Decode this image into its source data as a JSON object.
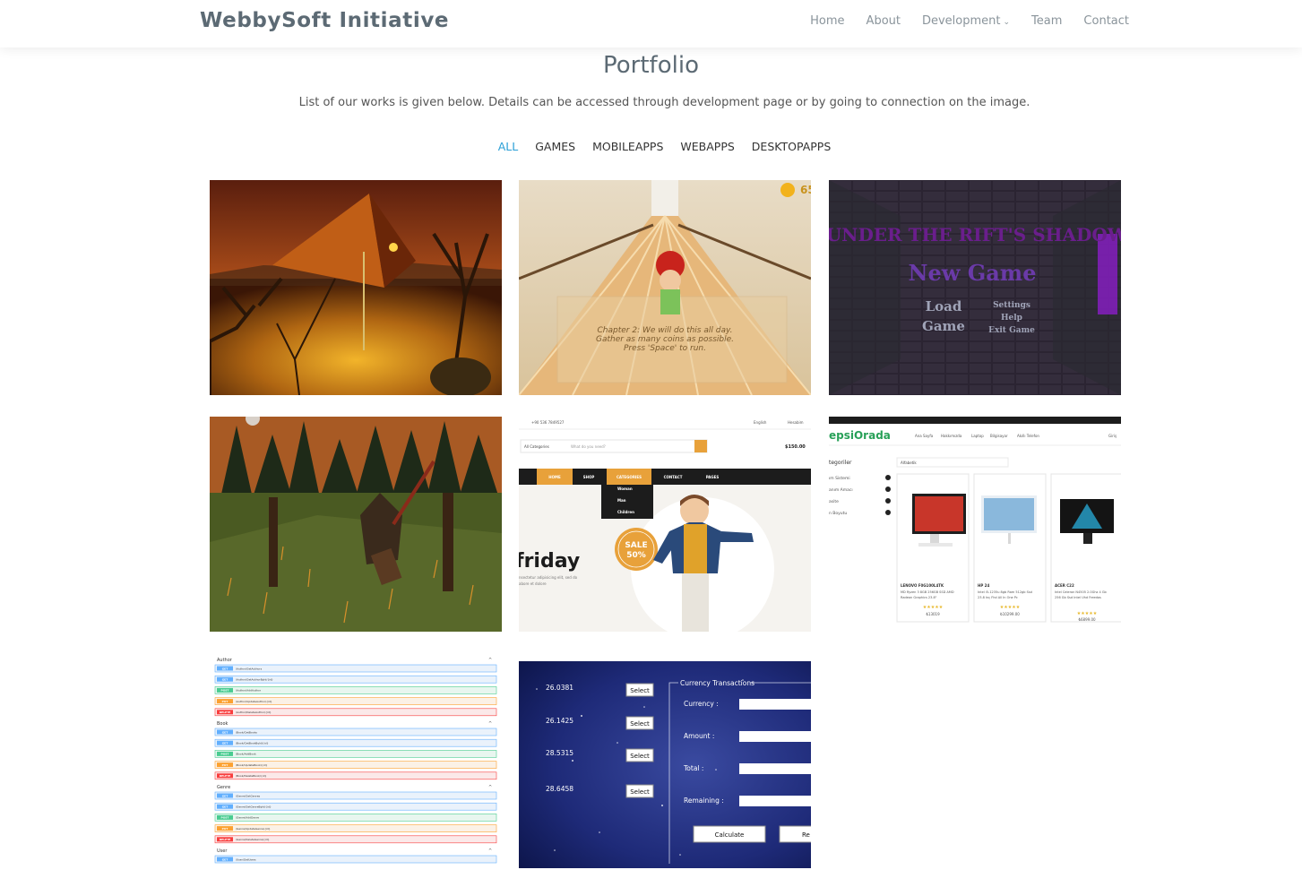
{
  "header": {
    "logo": "WebbySoft Initiative",
    "nav": {
      "home": "Home",
      "about": "About",
      "development": "Development",
      "team": "Team",
      "contact": "Contact"
    }
  },
  "portfolio": {
    "title": "Portfolio",
    "description": "List of our works is given below. Details can be accessed through development page or by going to connection on the image.",
    "filters": [
      "ALL",
      "GAMES",
      "MOBILEAPPS",
      "WEBAPPS",
      "DESKTOPAPPS"
    ],
    "active_filter": "ALL"
  },
  "items": {
    "runner": {
      "coins": "65",
      "chapter": "Chapter 2: We will do this all day.",
      "gather": "Gather as many coins as possible.",
      "press": "Press 'Space' to run."
    },
    "rift": {
      "title": "UNDER THE RIFT'S SHADOW",
      "new_game": "New Game",
      "load": "Load",
      "game": "Game",
      "settings": "Settings",
      "help": "Help",
      "exit": "Exit Game"
    },
    "shop": {
      "phone": "+90 536 7849527",
      "lang": "English",
      "account": "Hesabim",
      "categories": "All Categories",
      "search": "What do you need?",
      "price": "$150.00",
      "menu": [
        "HOME",
        "SHOP",
        "CATEGORIES",
        "CONTACT",
        "PAGES"
      ],
      "dropdown": [
        "Woman",
        "Man",
        "Children"
      ],
      "sale": "SALE",
      "percent": "50%",
      "headline": "friday",
      "sub1": "nsectetur adipisicing elit, sed do",
      "sub2": "abore et dolore"
    },
    "hepsi": {
      "brand": "epsiOrada",
      "nav": [
        "Ana Sayfa",
        "Hakkımızda",
        "Laptop",
        "Bilgisayar",
        "Akıllı Telefon"
      ],
      "login": "Giriş",
      "categories": "tegoriler",
      "search": "Alfabetik",
      "cats": [
        "ım Sistemi",
        "anım Amacı",
        "asite",
        "n Boyutu"
      ],
      "products": [
        {
          "name": "LENOVO F0G100L4TK",
          "desc1": "MD Ryzen 3 8GB 256GB SSD AMD",
          "desc2": "Radeon Graphics 23.8\"",
          "price": "₺13019"
        },
        {
          "name": "HP 24",
          "desc1": "Intel i5-1235u 8gb Ram 512gb Ssd",
          "desc2": "23.8 Inç Fhd All In One Pc",
          "price": "₺10299.00"
        },
        {
          "name": "ACER C22",
          "desc1": "Intel Celeron N4505 2.0Ghz 4 Gb",
          "desc2": "256 Gb Ssd Intel Uhd Freedos",
          "price": "₺6899.00"
        }
      ]
    },
    "api": {
      "groups": [
        {
          "name": "Author",
          "rows": [
            {
              "method": "GET",
              "path": "/Author/GetAuthors"
            },
            {
              "method": "GET",
              "path": "/Author/GetAuthorById/{id}"
            },
            {
              "method": "POST",
              "path": "/Author/AddAuthor"
            },
            {
              "method": "PUT",
              "path": "/Author/UpdateAuthor/{id}"
            },
            {
              "method": "DELETE",
              "path": "/Author/DeleteAuthor/{id}"
            }
          ]
        },
        {
          "name": "Book",
          "rows": [
            {
              "method": "GET",
              "path": "/Book/GetBooks"
            },
            {
              "method": "GET",
              "path": "/Book/GetBookById/{id}"
            },
            {
              "method": "POST",
              "path": "/Book/AddBook"
            },
            {
              "method": "PUT",
              "path": "/Book/UpdateBook/{id}"
            },
            {
              "method": "DELETE",
              "path": "/Book/DeleteBook/{id}"
            }
          ]
        },
        {
          "name": "Genre",
          "rows": [
            {
              "method": "GET",
              "path": "/Genre/GetGenres"
            },
            {
              "method": "GET",
              "path": "/Genre/GetGenreById/{id}"
            },
            {
              "method": "POST",
              "path": "/Genre/AddGenre"
            },
            {
              "method": "PUT",
              "path": "/Genre/UpdateGenre/{id}"
            },
            {
              "method": "DELETE",
              "path": "/Genre/DeleteGenre/{id}"
            }
          ]
        },
        {
          "name": "User",
          "rows": [
            {
              "method": "GET",
              "path": "/User/GetUsers"
            }
          ]
        }
      ]
    },
    "currency": {
      "rates": [
        "26.0381",
        "26.1425",
        "28.5315",
        "28.6458"
      ],
      "select": "Select",
      "panel": "Currency Transactions",
      "currency": "Currency :",
      "amount": "Amount :",
      "total": "Total :",
      "remaining": "Remaining :",
      "calculate": "Calculate",
      "reset": "Re"
    }
  },
  "colors": {
    "accent": "#2a9fd6",
    "logo": "#5c6a74",
    "shop_orange": "#e8a13a"
  }
}
